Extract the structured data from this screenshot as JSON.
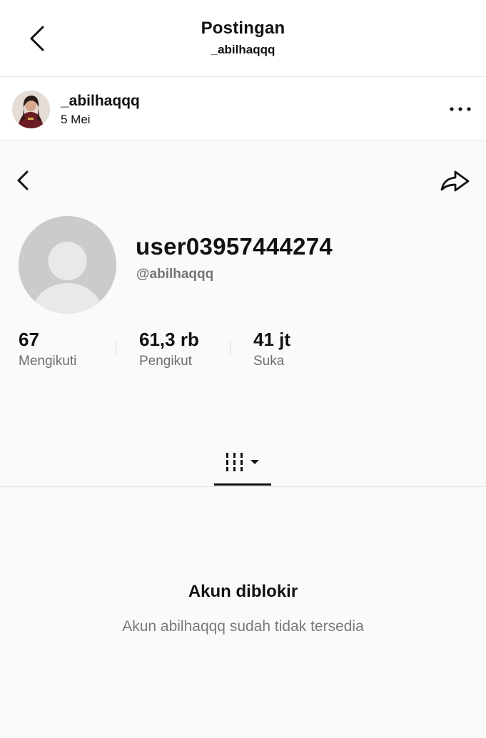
{
  "header": {
    "title": "Postingan",
    "subtitle": "_abilhaqqq",
    "back_icon": "chevron-left-icon"
  },
  "post": {
    "username": "_abilhaqqq",
    "date": "5 Mei",
    "more_icon": "more-horizontal-icon"
  },
  "profile": {
    "display_name": "user03957444274",
    "handle": "@abilhaqqq",
    "back_icon": "chevron-left-icon",
    "share_icon": "share-arrow-icon",
    "stats": [
      {
        "value": "67",
        "label": "Mengikuti"
      },
      {
        "value": "61,3 rb",
        "label": "Pengikut"
      },
      {
        "value": "41 jt",
        "label": "Suka"
      }
    ],
    "tab_icon": "grid-filter-icon"
  },
  "blocked": {
    "title": "Akun diblokir",
    "message": "Akun abilhaqqq sudah tidak tersedia"
  }
}
